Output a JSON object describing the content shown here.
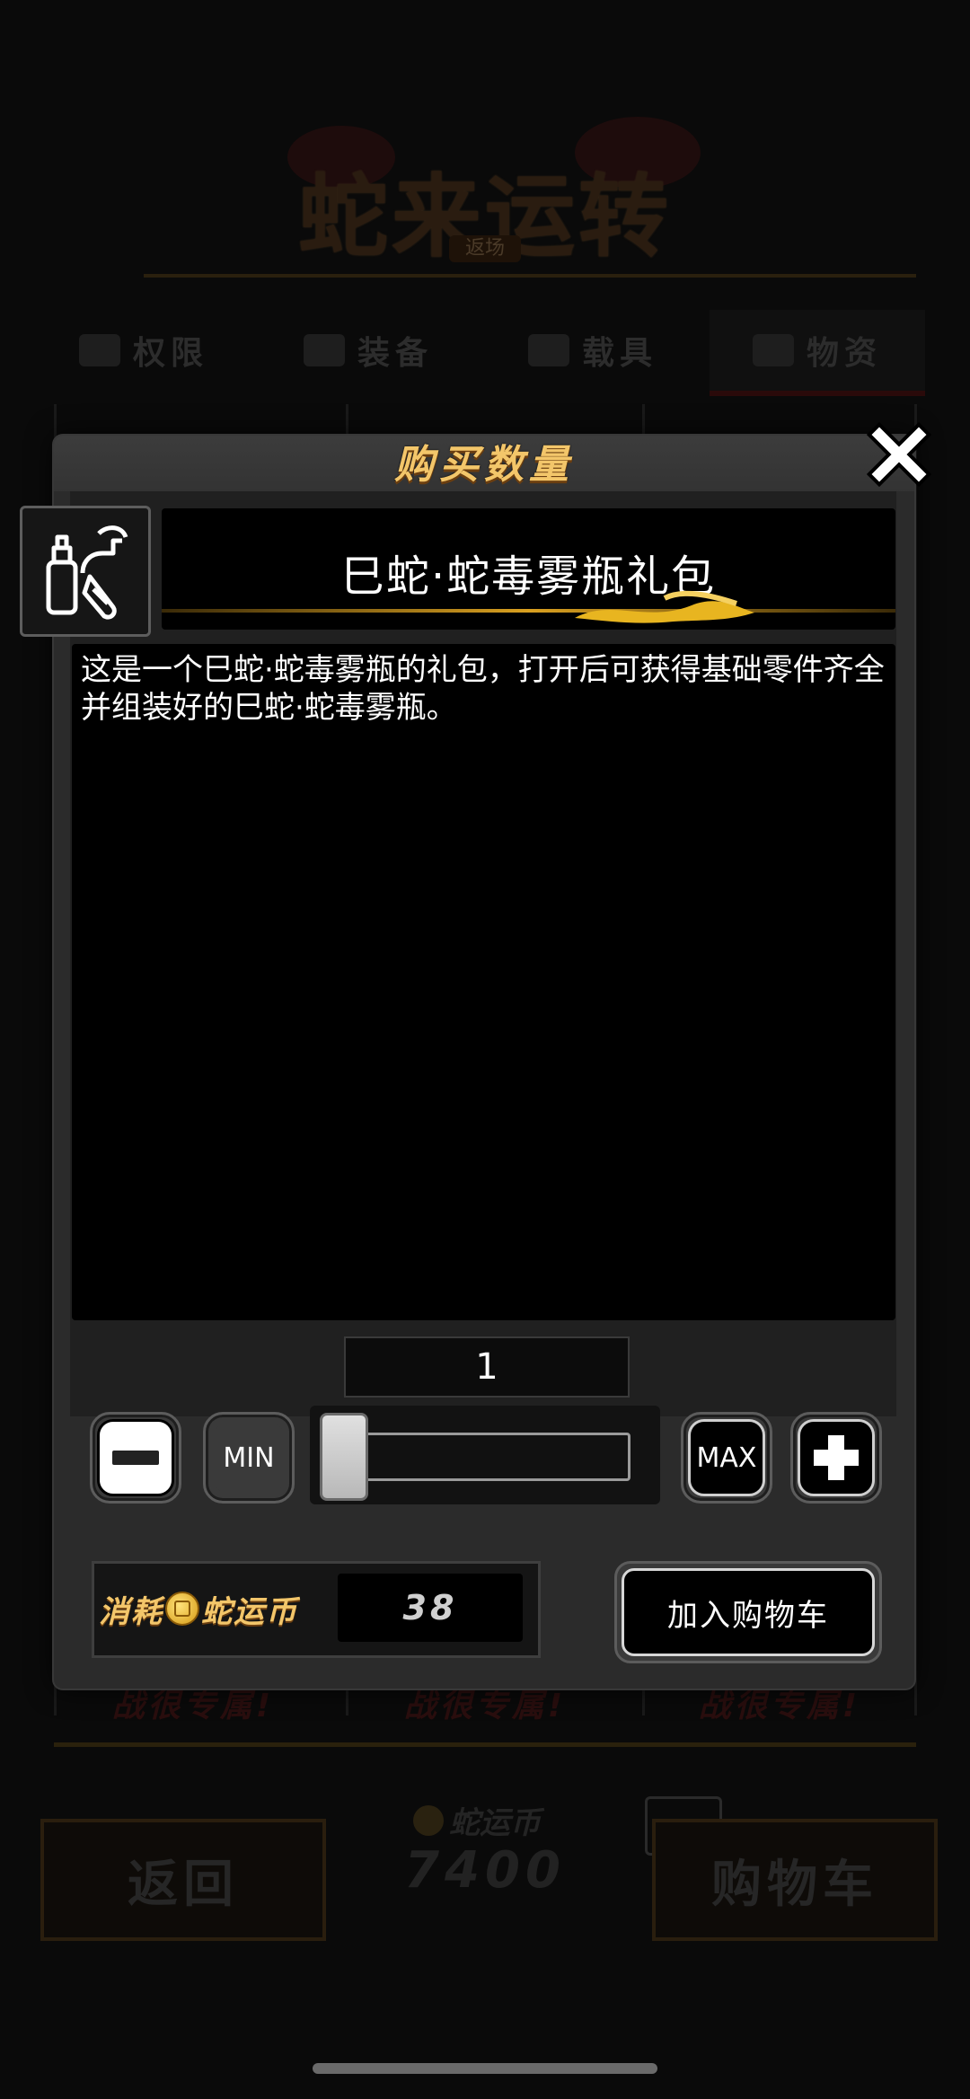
{
  "background": {
    "banner_title": "蛇来运转",
    "banner_subtitle": "返场",
    "tabs": [
      {
        "label": "权限",
        "icon": "box-icon"
      },
      {
        "label": "装备",
        "icon": "shield-icon"
      },
      {
        "label": "载具",
        "icon": "car-icon"
      },
      {
        "label": "物资",
        "icon": "crate-icon"
      }
    ],
    "promo_label": "战很专属!",
    "back_button": "返回",
    "coin_label": "蛇运币",
    "coin_balance": "7400",
    "cart_button": "购物车"
  },
  "modal": {
    "title": "购买数量",
    "close_icon": "close-icon",
    "item": {
      "icon": "spray-bottle-icon",
      "name": "巳蛇·蛇毒雾瓶礼包",
      "description": "这是一个巳蛇·蛇毒雾瓶的礼包，打开后可获得基础零件齐全并组装好的巳蛇·蛇毒雾瓶。"
    },
    "quantity": {
      "value": "1",
      "min_label": "MIN",
      "max_label": "MAX",
      "slider_fraction": 0
    },
    "cost": {
      "label_prefix": "消耗",
      "currency": "蛇运币",
      "value": "38"
    },
    "add_to_cart_button": "加入购物车"
  },
  "colors": {
    "accent_gold": "#f3c66a",
    "panel_bg": "#2b2b2b",
    "text_white": "#ffffff"
  }
}
